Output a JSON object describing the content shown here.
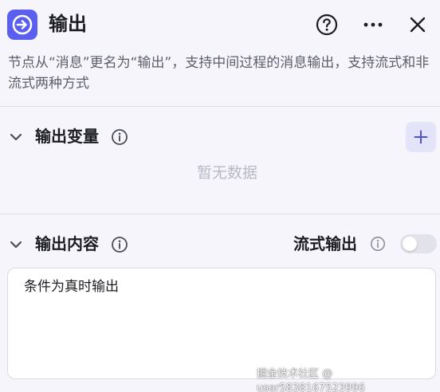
{
  "header": {
    "title": "输出",
    "icons": {
      "node": "arrow-right-circle-icon",
      "help": "help-icon",
      "more": "more-icon",
      "close": "close-icon"
    }
  },
  "description": "节点从“消息”更名为“输出”，支持中间过程的消息输出，支持流式和非流式两种方式",
  "variables": {
    "title": "输出变量",
    "empty_text": "暂无数据"
  },
  "content": {
    "title": "输出内容",
    "stream_label": "流式输出",
    "stream_enabled": false,
    "text": "条件为真时输出"
  },
  "watermark": "掘金技术社区 @ user5838167523996",
  "colors": {
    "accent": "#5a5ff0",
    "add_bg": "#e3e4f9",
    "muted": "#b8b9c4"
  }
}
